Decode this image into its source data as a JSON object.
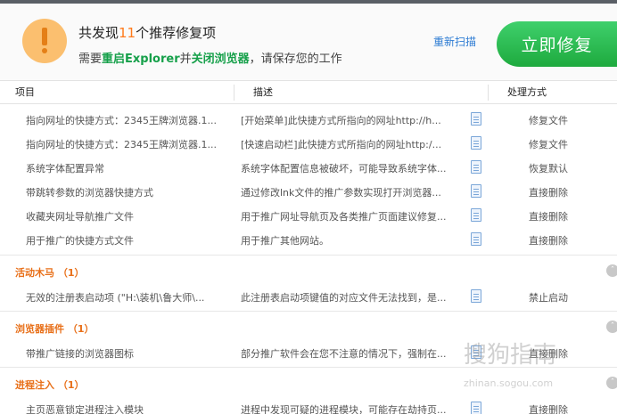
{
  "header": {
    "title_prefix": "共发现",
    "count": "11",
    "title_suffix": "个推荐修复项",
    "sub_1": "需要",
    "sub_2": "重启Explorer",
    "sub_3": "并",
    "sub_4": "关闭浏览器",
    "sub_5": "，请保存您的工作",
    "rescan": "重新扫描",
    "fix_button": "立即修复"
  },
  "columns": {
    "item": "项目",
    "desc": "描述",
    "action": "处理方式"
  },
  "rows_main": [
    {
      "item": "指向网址的快捷方式：2345王牌浏览器.1...",
      "desc": "[开始菜单]此快捷方式所指向的网址http://h...",
      "action": "修复文件"
    },
    {
      "item": "指向网址的快捷方式：2345王牌浏览器.1...",
      "desc": "[快速启动栏]此快捷方式所指向的网址http:/...",
      "action": "修复文件"
    },
    {
      "item": "系统字体配置异常",
      "desc": "系统字体配置信息被破坏，可能导致系统字体...",
      "action": "恢复默认"
    },
    {
      "item": "带跳转参数的浏览器快捷方式",
      "desc": "通过修改lnk文件的推广参数实现打开浏览器...",
      "action": "直接删除"
    },
    {
      "item": "收藏夹网址导航推广文件",
      "desc": "用于推广网址导航页及各类推广页面建议修复...",
      "action": "直接删除"
    },
    {
      "item": "用于推广的快捷方式文件",
      "desc": "用于推广其他网站。",
      "action": "直接删除"
    }
  ],
  "sections": [
    {
      "name": "活动木马 （1）",
      "rows": [
        {
          "item": "无效的注册表启动项 (\"H:\\装机\\鲁大师\\...",
          "desc": "此注册表启动项键值的对应文件无法找到，是...",
          "action": "禁止启动"
        }
      ]
    },
    {
      "name": "浏览器插件 （1）",
      "rows": [
        {
          "item": "带推广链接的浏览器图标",
          "desc": "部分推广软件会在您不注意的情况下，强制在...",
          "action": "直接删除"
        }
      ]
    },
    {
      "name": "进程注入 （1）",
      "rows": [
        {
          "item": "主页恶意锁定进程注入模块",
          "desc": "进程中发现可疑的进程模块，可能存在劫持页...",
          "action": "直接删除"
        }
      ]
    }
  ],
  "watermark": {
    "line1": "搜狗指南",
    "line2": "zhinan.sogou.com"
  },
  "colors": {
    "accent_orange": "#e8701a",
    "button_green": "#1eaa3e",
    "link_blue": "#2c7bd3",
    "count_orange": "#ff7a1a"
  }
}
